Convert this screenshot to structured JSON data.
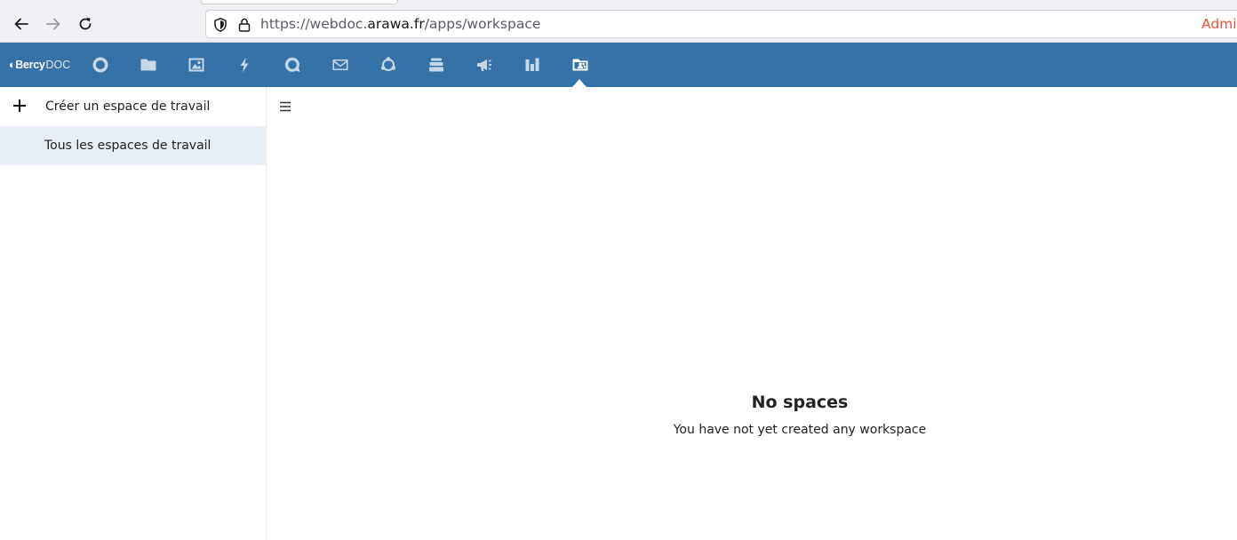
{
  "browser": {
    "url_prefix": "https://webdoc.",
    "url_host": "arawa.fr",
    "url_path": "/apps/workspace",
    "right_label": "Admin"
  },
  "header": {
    "logo_mark": "◐Bercy",
    "logo_suffix": "DOC",
    "apps": [
      {
        "name": "dashboard",
        "icon": "circle-icon"
      },
      {
        "name": "files",
        "icon": "folder-icon"
      },
      {
        "name": "photos",
        "icon": "image-icon"
      },
      {
        "name": "activity",
        "icon": "lightning-icon"
      },
      {
        "name": "talk",
        "icon": "chat-bubble-icon"
      },
      {
        "name": "mail",
        "icon": "envelope-icon"
      },
      {
        "name": "circles",
        "icon": "circles-icon"
      },
      {
        "name": "deck",
        "icon": "stack-icon"
      },
      {
        "name": "announcements",
        "icon": "megaphone-icon"
      },
      {
        "name": "analytics",
        "icon": "bar-chart-icon"
      },
      {
        "name": "workspace",
        "icon": "workspace-folder-icon",
        "active": true
      }
    ],
    "colors": {
      "bar": "#3472a8"
    }
  },
  "sidebar": {
    "create_label": "Créer un espace de travail",
    "all_spaces_label": "Tous les espaces de travail"
  },
  "main": {
    "empty_title": "No spaces",
    "empty_text": "You have not yet created any workspace"
  }
}
